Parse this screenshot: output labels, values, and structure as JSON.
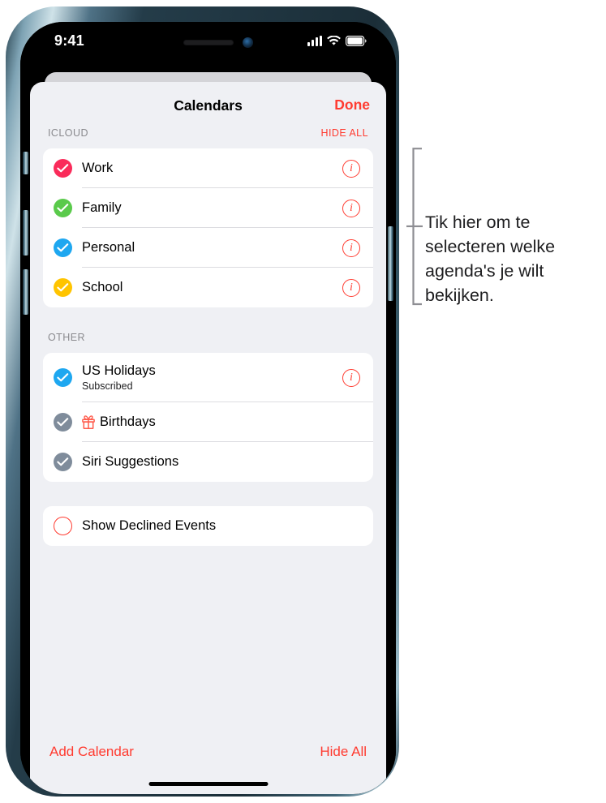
{
  "status_bar": {
    "time": "9:41",
    "signal_icon": "cellular-bars-icon",
    "wifi_icon": "wifi-icon",
    "battery_icon": "battery-full-icon"
  },
  "nav": {
    "title": "Calendars",
    "done_label": "Done"
  },
  "sections": [
    {
      "id": "icloud",
      "title": "ICLOUD",
      "action_label": "HIDE ALL",
      "rows": [
        {
          "label": "Work",
          "checked": true,
          "color": "#fa2b5a",
          "info": true
        },
        {
          "label": "Family",
          "checked": true,
          "color": "#5aca4b",
          "info": true
        },
        {
          "label": "Personal",
          "checked": true,
          "color": "#1ea7f0",
          "info": true
        },
        {
          "label": "School",
          "checked": true,
          "color": "#ffc400",
          "info": true
        }
      ]
    },
    {
      "id": "other",
      "title": "OTHER",
      "action_label": "",
      "rows": [
        {
          "label": "US Holidays",
          "subtitle": "Subscribed",
          "checked": true,
          "color": "#1ea7f0",
          "info": true
        },
        {
          "label": "Birthdays",
          "checked": true,
          "color": "#7f8c9b",
          "info": false,
          "icon": "gift-icon",
          "icon_color": "#ff5c4d"
        },
        {
          "label": "Siri Suggestions",
          "checked": true,
          "color": "#7f8c9b",
          "info": false
        }
      ]
    }
  ],
  "declined": {
    "label": "Show Declined Events",
    "checked": false,
    "outline_color": "#ff3b30"
  },
  "toolbar": {
    "add_label": "Add Calendar",
    "hide_all_label": "Hide All"
  },
  "annotation": {
    "text": "Tik hier om te selecteren welke agenda's je wilt bekijken.",
    "bracket_color": "#8e8e93"
  },
  "colors": {
    "accent_red": "#ff3b30",
    "sheet_background": "#eff0f4",
    "card_background": "#ffffff",
    "separator": "#dcdce0",
    "section_label": "#8a8a8e"
  }
}
